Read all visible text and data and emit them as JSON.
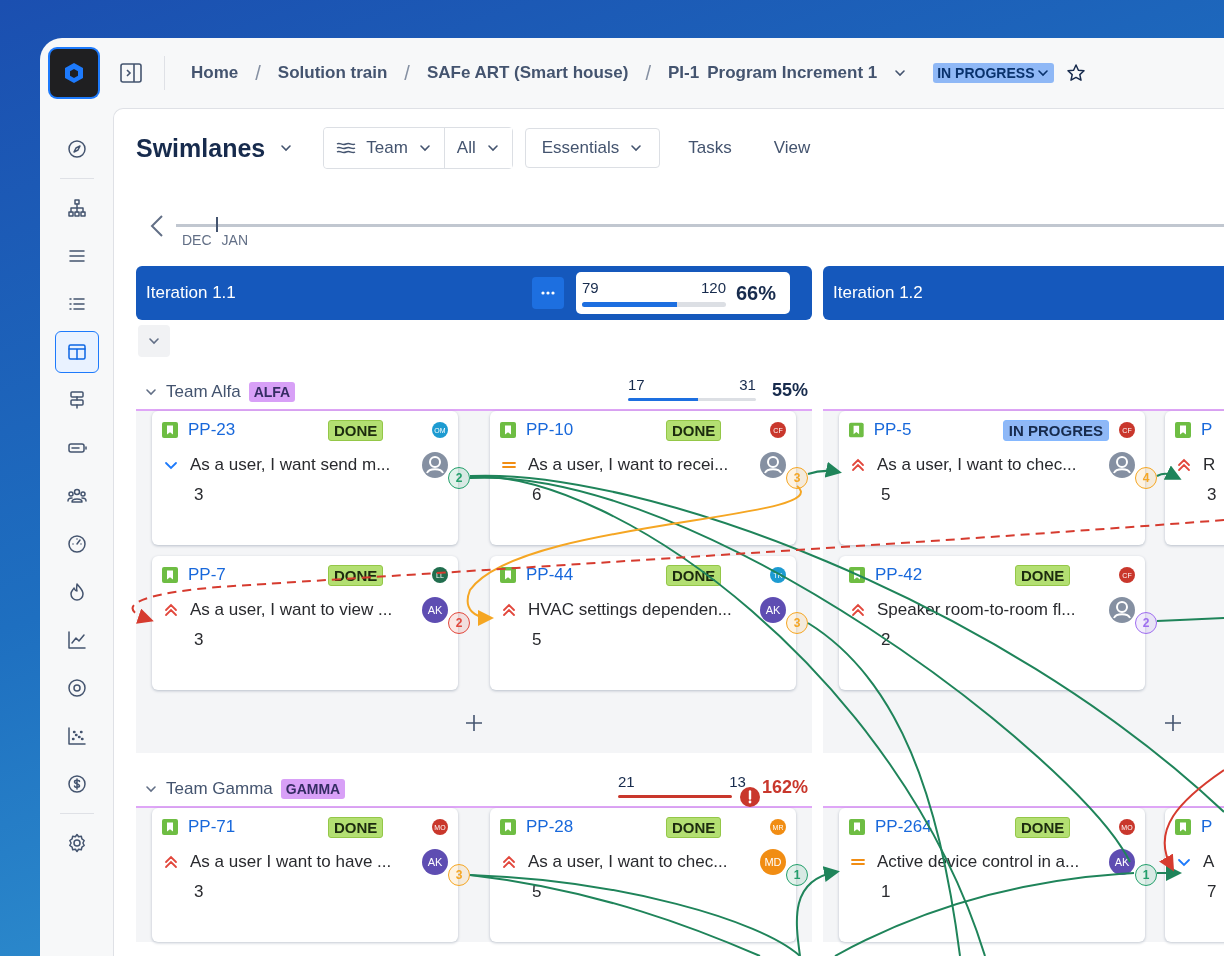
{
  "topbar": {
    "breadcrumbs": [
      {
        "label": "Home",
        "separator": "/"
      },
      {
        "label": "Solution train",
        "separator": "/"
      },
      {
        "label": "SAFe ART (Smart house)",
        "separator": "/"
      }
    ],
    "increment": {
      "key": "PI-1",
      "name": "Program Increment 1"
    },
    "status": "IN PROGRESS"
  },
  "sidebar": {
    "items": [
      {
        "kind": "compass",
        "selected": false
      },
      {
        "kind": "hierarchy",
        "selected": false
      },
      {
        "kind": "lines",
        "selected": false
      },
      {
        "kind": "list",
        "selected": false
      },
      {
        "kind": "board",
        "selected": true
      },
      {
        "kind": "roadmap",
        "selected": false
      },
      {
        "kind": "capacity",
        "selected": false
      },
      {
        "kind": "people",
        "selected": false
      },
      {
        "kind": "gauge",
        "selected": false
      },
      {
        "kind": "flame",
        "selected": false
      },
      {
        "kind": "linechart",
        "selected": false
      },
      {
        "kind": "target",
        "selected": false
      },
      {
        "kind": "scatter",
        "selected": false
      },
      {
        "kind": "dollar",
        "selected": false
      },
      {
        "kind": "settings",
        "selected": false
      }
    ]
  },
  "toolbar": {
    "view": "Swimlanes",
    "group_by": "Team",
    "filter": "All",
    "fields": "Essentials",
    "actions": [
      "Tasks",
      "View"
    ]
  },
  "timeline": {
    "months": [
      "DEC",
      "JAN"
    ]
  },
  "iterations": [
    {
      "title": "Iteration 1.1",
      "progress": {
        "done": "79",
        "total": "120",
        "level": 0.66,
        "percent": "66%"
      }
    },
    {
      "title": "Iteration 1.2"
    }
  ],
  "teams": [
    {
      "name": "Team Alfa",
      "tag": "ALFA",
      "expanded": true,
      "progress": {
        "done": "17",
        "total": "31",
        "level": 0.55,
        "percent": "55%",
        "overloaded": false
      },
      "iterations": [
        {
          "add_card": true,
          "columns": [
            [
              {
                "id": "PP-23",
                "status": {
                  "label": "DONE",
                  "kind": "done"
                },
                "reporter": {
                  "initials": "OM",
                  "color": "#1d9bd1"
                },
                "priority": {
                  "kind": "low"
                },
                "summary": "As a user, I want send m...",
                "assignee": {
                  "kind": "none"
                },
                "points": "3",
                "dependency": {
                  "count": "2",
                  "color": "#22a06b"
                }
              },
              {
                "id": "PP-7",
                "status": {
                  "label": "DONE",
                  "kind": "done"
                },
                "reporter": {
                  "initials": "LL",
                  "color": "#216e4e"
                },
                "priority": {
                  "kind": "high"
                },
                "summary": "As a user, I want to view ...",
                "assignee": {
                  "kind": "person",
                  "initials": "AK",
                  "color": "#5e4db2"
                },
                "points": "3",
                "dependency": {
                  "count": "2",
                  "color": "#e2483d"
                }
              }
            ],
            [
              {
                "id": "PP-10",
                "status": {
                  "label": "DONE",
                  "kind": "done"
                },
                "reporter": {
                  "initials": "CF",
                  "color": "#c9372c"
                },
                "priority": {
                  "kind": "medium"
                },
                "summary": "As a user, I want to recei...",
                "assignee": {
                  "kind": "none"
                },
                "points": "6",
                "dependency": {
                  "count": "3",
                  "color": "#f5a623"
                }
              },
              {
                "id": "PP-44",
                "status": {
                  "label": "DONE",
                  "kind": "done"
                },
                "reporter": {
                  "initials": "TK",
                  "color": "#1d9bd1"
                },
                "priority": {
                  "kind": "high"
                },
                "summary": "HVAC settings dependen...",
                "assignee": {
                  "kind": "person",
                  "initials": "AK",
                  "color": "#5e4db2"
                },
                "points": "5",
                "dependency": {
                  "count": "3",
                  "color": "#f5a623"
                }
              }
            ]
          ]
        },
        {
          "add_card": true,
          "columns": [
            [
              {
                "id": "PP-5",
                "status": {
                  "label": "IN PROGRES",
                  "kind": "in_progress"
                },
                "reporter": {
                  "initials": "CF",
                  "color": "#c9372c"
                },
                "priority": {
                  "kind": "high"
                },
                "summary": "As a user, I want to chec...",
                "assignee": {
                  "kind": "none"
                },
                "points": "5",
                "dependency": {
                  "count": "4",
                  "color": "#f5a623"
                }
              },
              {
                "id": "PP-42",
                "status": {
                  "label": "DONE",
                  "kind": "done"
                },
                "reporter": {
                  "initials": "CF",
                  "color": "#c9372c"
                },
                "priority": {
                  "kind": "high"
                },
                "summary": "Speaker room-to-room fl...",
                "assignee": {
                  "kind": "none"
                },
                "points": "2",
                "dependency": {
                  "count": "2",
                  "color": "#9f6ef0"
                }
              }
            ],
            [
              {
                "id": "P",
                "priority": {
                  "kind": "high"
                },
                "summary": "R",
                "points": "3"
              }
            ]
          ]
        }
      ]
    },
    {
      "name": "Team Gamma",
      "tag": "GAMMA",
      "expanded": true,
      "progress": {
        "done": "21",
        "total": "13",
        "level": 1,
        "percent": "162%",
        "overloaded": true
      },
      "iterations": [
        {
          "add_card": false,
          "columns": [
            [
              {
                "id": "PP-71",
                "status": {
                  "label": "DONE",
                  "kind": "done"
                },
                "reporter": {
                  "initials": "MO",
                  "color": "#c9372c"
                },
                "priority": {
                  "kind": "high"
                },
                "summary": "As a user I want to have ...",
                "assignee": {
                  "kind": "person",
                  "initials": "AK",
                  "color": "#5e4db2"
                },
                "points": "3",
                "dependency": {
                  "count": "3",
                  "color": "#f5a623"
                }
              }
            ],
            [
              {
                "id": "PP-28",
                "status": {
                  "label": "DONE",
                  "kind": "done"
                },
                "reporter": {
                  "initials": "MR",
                  "color": "#f18d13"
                },
                "priority": {
                  "kind": "high"
                },
                "summary": "As a user, I want to chec...",
                "assignee": {
                  "kind": "person",
                  "initials": "MD",
                  "color": "#f18d13"
                },
                "points": "5",
                "dependency": {
                  "count": "1",
                  "color": "#22a06b"
                }
              }
            ]
          ]
        },
        {
          "add_card": false,
          "columns": [
            [
              {
                "id": "PP-264",
                "status": {
                  "label": "DONE",
                  "kind": "done"
                },
                "reporter": {
                  "initials": "MO",
                  "color": "#c9372c"
                },
                "priority": {
                  "kind": "medium"
                },
                "summary": "Active device control in a...",
                "assignee": {
                  "kind": "person",
                  "initials": "AK",
                  "color": "#5e4db2"
                },
                "points": "1",
                "dependency": {
                  "count": "1",
                  "color": "#22a06b"
                }
              }
            ],
            [
              {
                "id": "P",
                "priority": {
                  "kind": "low"
                },
                "summary": "A",
                "points": "7"
              }
            ]
          ]
        }
      ]
    }
  ]
}
